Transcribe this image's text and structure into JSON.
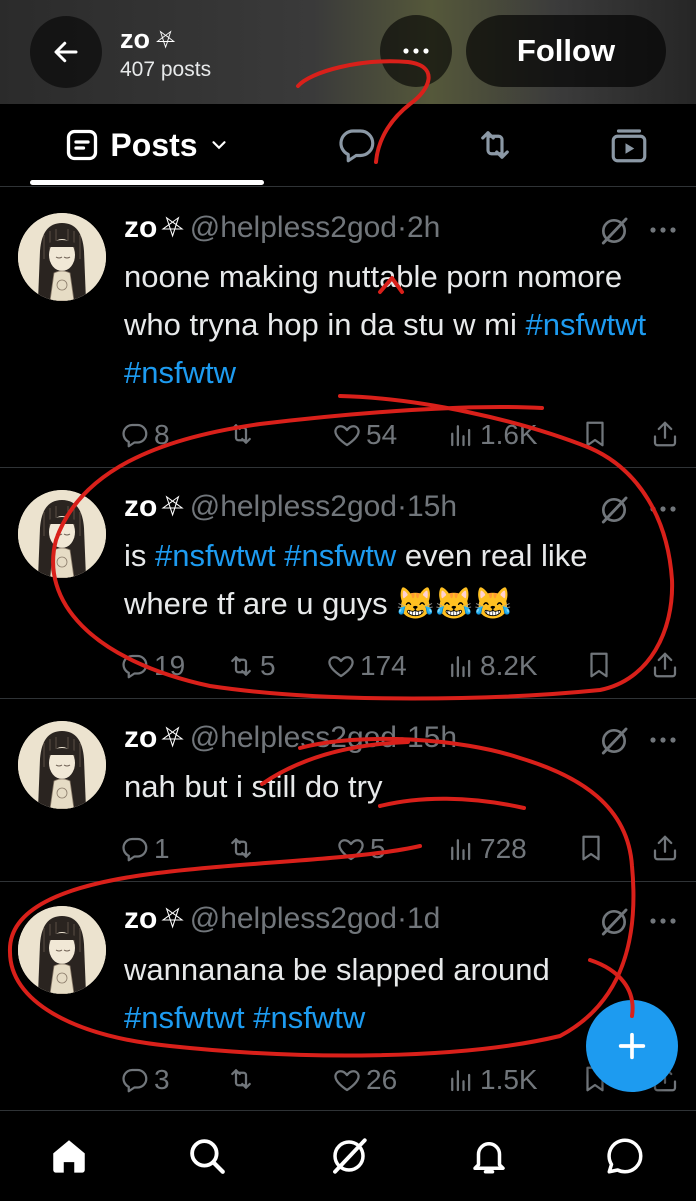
{
  "header": {
    "name": "zo",
    "name_symbol": "⛧",
    "post_count": "407 posts",
    "follow_label": "Follow"
  },
  "tabs": {
    "active_label": "Posts",
    "items": [
      "Posts",
      "replies-icon",
      "reposts-icon",
      "media-icon"
    ]
  },
  "posts": [
    {
      "name": "zo",
      "symbol": "⛧",
      "handle": "@helpless2god",
      "time": "2h",
      "text_plain": "noone making nuttable porn nomore who tryna hop in da stu w mi ",
      "tags": [
        "#nsfwtwt",
        "#nsfwtw"
      ],
      "replies": "8",
      "reposts": "",
      "likes": "54",
      "views": "1.6K"
    },
    {
      "name": "zo",
      "symbol": "⛧",
      "handle": "@helpless2god",
      "time": "15h",
      "text_before": "is ",
      "tags": [
        "#nsfwtwt",
        "#nsfwtw"
      ],
      "text_after": " even real like where tf are u guys 😹😹😹",
      "replies": "19",
      "reposts": "5",
      "likes": "174",
      "views": "8.2K"
    },
    {
      "name": "zo",
      "symbol": "⛧",
      "handle": "@helpless2god",
      "time": "15h",
      "text_plain": "nah but i still do try",
      "replies": "1",
      "reposts": "",
      "likes": "5",
      "views": "728"
    },
    {
      "name": "zo",
      "symbol": "⛧",
      "handle": "@helpless2god",
      "time": "1d",
      "text_plain": "wannanana be slapped around",
      "tags": [
        "#nsfwtwt",
        "#nsfwtw"
      ],
      "replies": "3",
      "reposts": "",
      "likes": "26",
      "views": "1.5K"
    }
  ],
  "colors": {
    "accent": "#1d9bf0",
    "text": "#e7e9ea",
    "muted": "#71767b",
    "background": "#000000",
    "annotation": "#d9201a"
  },
  "bottom_nav": [
    "home-icon",
    "search-icon",
    "grok-icon",
    "notifications-icon",
    "messages-icon"
  ]
}
